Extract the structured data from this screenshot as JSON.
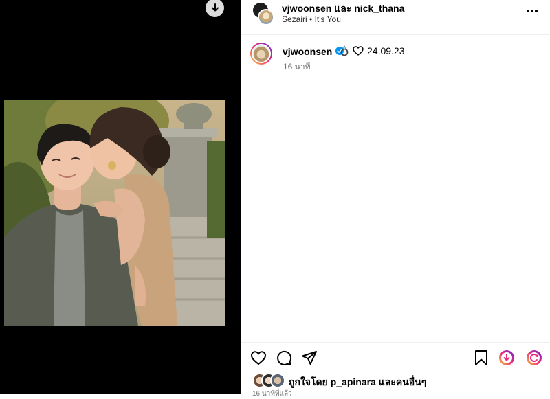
{
  "header": {
    "collab_title": "vjwoonsen และ nick_thana",
    "audio_artist": "Sezairi",
    "audio_separator": "•",
    "audio_track": "It's You"
  },
  "caption": {
    "username": "vjwoonsen",
    "date_text": "24.09.23",
    "time_ago": "16 นาที"
  },
  "likes": {
    "text": "ถูกใจโดย p_apinara และคนอื่นๆ"
  },
  "post_time": "16 นาทีที่แล้ว",
  "icons": {
    "download": "download-icon",
    "more": "more-options-icon",
    "verified": "verified-badge-icon",
    "ring": "ring-emoji-icon",
    "heart_outline": "heart-icon",
    "comment": "comment-icon",
    "share": "share-icon",
    "bookmark": "bookmark-icon"
  },
  "colors": {
    "verified_blue": "#0095f6",
    "secondary_text": "#737373",
    "divider": "#efefef",
    "gradient_start": "#f9ce34",
    "gradient_mid": "#ee2a7b",
    "gradient_end": "#6228d7"
  }
}
